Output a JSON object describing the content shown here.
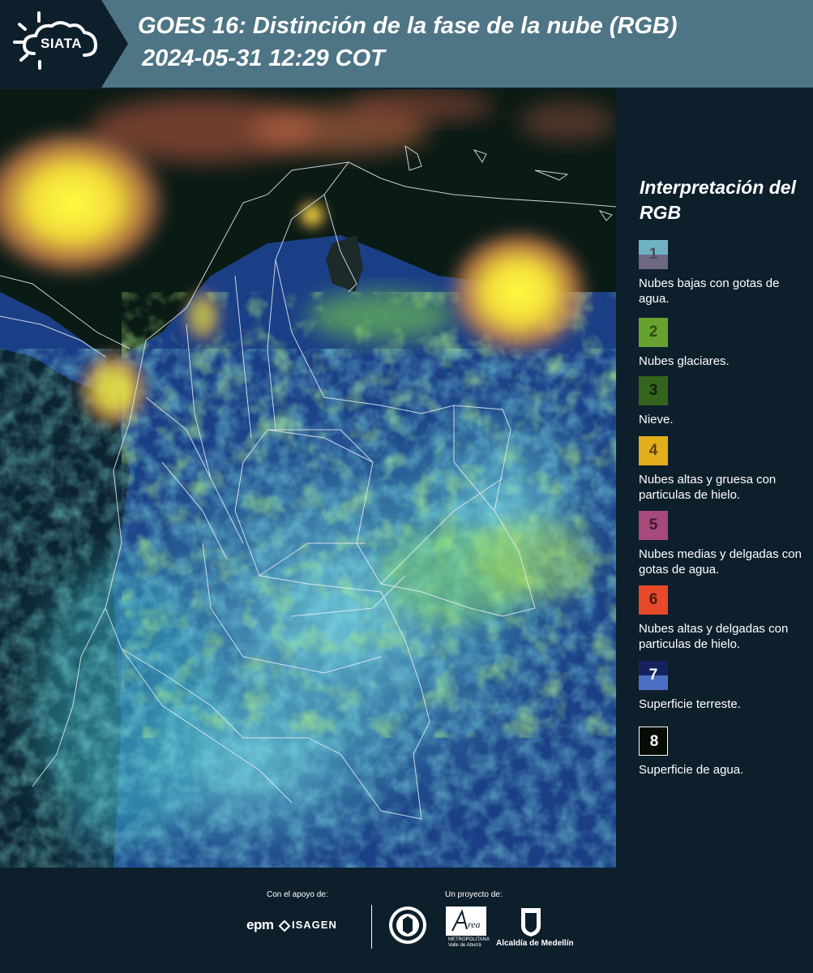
{
  "header": {
    "logo": "SIATA",
    "title": "GOES 16: Distinción de la fase de la nube (RGB)",
    "subtitle": "2024-05-31 12:29 COT"
  },
  "legend": {
    "title": "Interpretación del RGB",
    "items": [
      {
        "num": "1",
        "label": "Nubes bajas con gotas de agua.",
        "color_top": "#6fb2c2",
        "color_bottom": "#6f6883",
        "num_color": "#4a4a5a"
      },
      {
        "num": "2",
        "label": "Nubes glaciares.",
        "color_top": "#68a22e",
        "color_bottom": "#68a22e",
        "num_color": "#2c4a16"
      },
      {
        "num": "3",
        "label": "Nieve.",
        "color_top": "#35641c",
        "color_bottom": "#35641c",
        "num_color": "#0e1f10"
      },
      {
        "num": "4",
        "label": "Nubes altas y gruesa con particulas de hielo.",
        "color_top": "#e2ae1c",
        "color_bottom": "#e2ae1c",
        "num_color": "#5a4310"
      },
      {
        "num": "5",
        "label": "Nubes medias y delgadas con gotas de agua.",
        "color_top": "#a6497b",
        "color_bottom": "#a6497b",
        "num_color": "#3e1a2e"
      },
      {
        "num": "6",
        "label": "Nubes altas y delgadas con particulas de hielo.",
        "color_top": "#e7492a",
        "color_bottom": "#e7492a",
        "num_color": "#4a1a10"
      },
      {
        "num": "7",
        "label": "Superficie terreste.",
        "color_top": "#14235f",
        "color_bottom": "#4d6fc3",
        "num_color": "#ffffff"
      },
      {
        "num": "8",
        "label": "Superficie de agua.",
        "color_top": "#060b06",
        "color_bottom": "#060b06",
        "num_color": "#ffffff"
      }
    ]
  },
  "footer": {
    "support_label": "Con el apoyo de:",
    "project_label": "Un proyecto de:",
    "sponsor_1": "epm",
    "sponsor_2": "ISAGEN",
    "partner_area": "Área",
    "partner_area_sub": "METROPOLITANA Valle de Aburrá",
    "partner_alcaldia": "Alcaldía de Medellín"
  }
}
